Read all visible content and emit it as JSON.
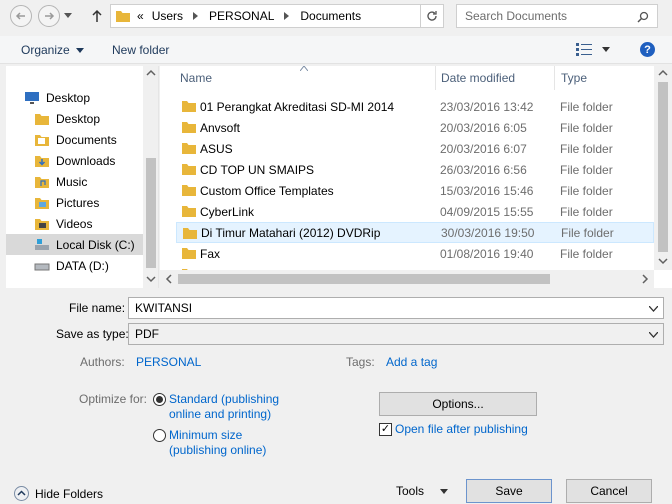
{
  "address": {
    "prefix": "«",
    "crumbs": [
      "Users",
      "PERSONAL",
      "Documents"
    ],
    "search_placeholder": "Search Documents"
  },
  "toolbar": {
    "organize": "Organize",
    "new_folder": "New folder"
  },
  "nav": {
    "items": [
      {
        "label": "Desktop",
        "icon": "desktop-icon"
      },
      {
        "label": "Desktop",
        "icon": "folder-icon"
      },
      {
        "label": "Documents",
        "icon": "documents-icon"
      },
      {
        "label": "Downloads",
        "icon": "downloads-icon"
      },
      {
        "label": "Music",
        "icon": "music-icon"
      },
      {
        "label": "Pictures",
        "icon": "pictures-icon"
      },
      {
        "label": "Videos",
        "icon": "videos-icon"
      },
      {
        "label": "Local Disk (C:)",
        "icon": "drive-icon"
      },
      {
        "label": "DATA (D:)",
        "icon": "drive-icon"
      }
    ]
  },
  "columns": {
    "name": "Name",
    "date": "Date modified",
    "type": "Type"
  },
  "files": [
    {
      "name": "01 Perangkat Akreditasi SD-MI 2014",
      "date": "23/03/2016 13:42",
      "type": "File folder"
    },
    {
      "name": "Anvsoft",
      "date": "20/03/2016 6:05",
      "type": "File folder"
    },
    {
      "name": "ASUS",
      "date": "20/03/2016 6:07",
      "type": "File folder"
    },
    {
      "name": "CD TOP UN SMAIPS",
      "date": "26/03/2016 6:56",
      "type": "File folder"
    },
    {
      "name": "Custom Office Templates",
      "date": "15/03/2016 15:46",
      "type": "File folder"
    },
    {
      "name": "CyberLink",
      "date": "04/09/2015 15:55",
      "type": "File folder"
    },
    {
      "name": "Di Timur Matahari (2012) DVDRip",
      "date": "30/03/2016 19:50",
      "type": "File folder"
    },
    {
      "name": "Fax",
      "date": "01/08/2016 19:40",
      "type": "File folder"
    }
  ],
  "form": {
    "filename_label": "File name:",
    "filename_value": "KWITANSI",
    "savetype_label": "Save as type:",
    "savetype_value": "PDF",
    "authors_label": "Authors:",
    "authors_value": "PERSONAL",
    "tags_label": "Tags:",
    "tags_value": "Add a tag",
    "optimize_label": "Optimize for:",
    "opt_standard": [
      "Standard (publishing",
      "online and printing)"
    ],
    "opt_minimum": [
      "Minimum size",
      "(publishing online)"
    ],
    "options_button": "Options...",
    "open_after": "Open file after publishing"
  },
  "footer": {
    "hide_folders": "Hide Folders",
    "tools": "Tools",
    "save": "Save",
    "cancel": "Cancel"
  },
  "colors": {
    "folder": "#e8b63a",
    "selected_row": "#e5f3ff",
    "link": "#0066cc"
  }
}
